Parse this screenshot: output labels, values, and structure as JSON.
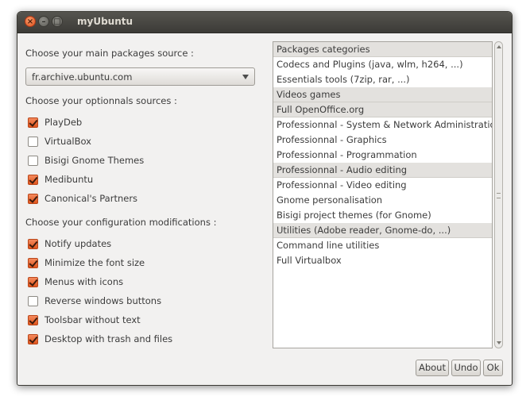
{
  "window": {
    "title": "myUbuntu"
  },
  "left": {
    "main_source_label": "Choose your main packages source :",
    "main_source_value": "fr.archive.ubuntu.com",
    "optional_label": "Choose your optionnals sources :",
    "optional_sources": [
      {
        "label": "PlayDeb",
        "checked": true
      },
      {
        "label": "VirtualBox",
        "checked": false
      },
      {
        "label": "Bisigi Gnome Themes",
        "checked": false
      },
      {
        "label": "Medibuntu",
        "checked": true
      },
      {
        "label": "Canonical's Partners",
        "checked": true
      }
    ],
    "config_label": "Choose your configuration modifications :",
    "config_mods": [
      {
        "label": "Notify updates",
        "checked": true
      },
      {
        "label": "Minimize the font size",
        "checked": true
      },
      {
        "label": "Menus with icons",
        "checked": true
      },
      {
        "label": "Reverse windows buttons",
        "checked": false
      },
      {
        "label": "Toolsbar without text",
        "checked": true
      },
      {
        "label": "Desktop with trash and files",
        "checked": true
      }
    ]
  },
  "packages": {
    "header": "Packages categories",
    "items": [
      {
        "label": "Codecs and Plugins (java, wlm, h264, ...)",
        "highlight": false
      },
      {
        "label": "Essentials tools (7zip, rar, ...)",
        "highlight": false
      },
      {
        "label": "Videos games",
        "highlight": true
      },
      {
        "label": "Full OpenOffice.org",
        "highlight": true
      },
      {
        "label": "Professionnal - System & Network Administration",
        "highlight": false
      },
      {
        "label": "Professionnal - Graphics",
        "highlight": false
      },
      {
        "label": "Professionnal - Programmation",
        "highlight": false
      },
      {
        "label": "Professionnal - Audio editing",
        "highlight": true
      },
      {
        "label": "Professionnal - Video editing",
        "highlight": false
      },
      {
        "label": "Gnome personalisation",
        "highlight": false
      },
      {
        "label": "Bisigi project themes (for Gnome)",
        "highlight": false
      },
      {
        "label": "Utilities (Adobe reader, Gnome-do, ...)",
        "highlight": true
      },
      {
        "label": "Command line utilities",
        "highlight": false
      },
      {
        "label": "Full Virtualbox",
        "highlight": false
      }
    ]
  },
  "buttons": {
    "about": "About",
    "undo": "Undo",
    "ok": "Ok"
  },
  "colors": {
    "accent": "#e75a1f",
    "titlebar": "#3c3b37"
  }
}
